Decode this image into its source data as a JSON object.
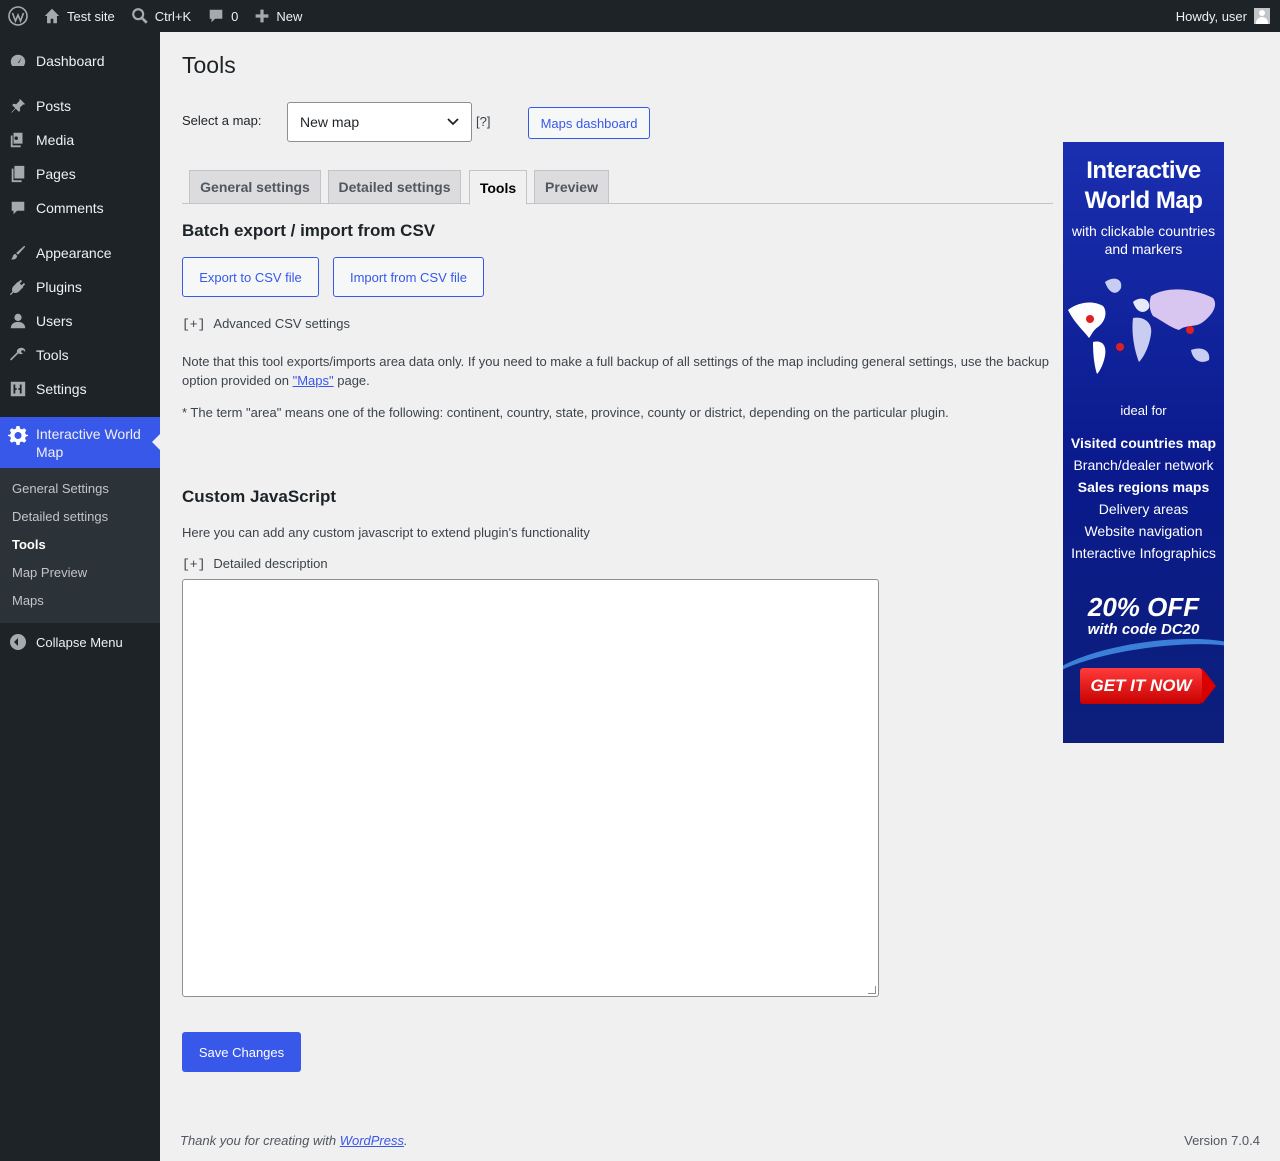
{
  "adminbar": {
    "site_name": "Test site",
    "search_shortcut": "Ctrl+K",
    "comments_count": "0",
    "new_label": "New",
    "howdy": "Howdy, user"
  },
  "sidebar": {
    "items": [
      {
        "label": "Dashboard",
        "icon": "dashboard-icon"
      },
      {
        "label": "Posts",
        "icon": "pin-icon"
      },
      {
        "label": "Media",
        "icon": "media-icon"
      },
      {
        "label": "Pages",
        "icon": "pages-icon"
      },
      {
        "label": "Comments",
        "icon": "comment-icon"
      },
      {
        "label": "Appearance",
        "icon": "brush-icon"
      },
      {
        "label": "Plugins",
        "icon": "plug-icon"
      },
      {
        "label": "Users",
        "icon": "user-icon"
      },
      {
        "label": "Tools",
        "icon": "wrench-icon"
      },
      {
        "label": "Settings",
        "icon": "sliders-icon"
      }
    ],
    "current": {
      "label": "Interactive World Map",
      "icon": "gear-icon"
    },
    "submenu": [
      "General Settings",
      "Detailed settings",
      "Tools",
      "Map Preview",
      "Maps"
    ],
    "submenu_active": "Tools",
    "collapse_label": "Collapse Menu"
  },
  "page": {
    "title": "Tools",
    "select_label": "Select a map:",
    "selected_map": "New map",
    "help": "[?]",
    "maps_dashboard": "Maps dashboard",
    "tabs": [
      "General settings",
      "Detailed settings",
      "Tools",
      "Preview"
    ],
    "active_tab": "Tools"
  },
  "csv": {
    "heading": "Batch export / import from CSV",
    "export_label": "Export to CSV file",
    "import_label": "Import from CSV file",
    "toggle": "[+]",
    "advanced_label": "Advanced CSV settings",
    "note_before": "Note that this tool exports/imports area data only. If you need to make a full backup of all settings of the map including general settings, use the backup option provided on ",
    "note_link": "\"Maps\"",
    "note_after": " page.",
    "term_note": "* The term \"area\" means one of the following: continent, country, state, province, county or district, depending on the particular plugin."
  },
  "custom_js": {
    "heading": "Custom JavaScript",
    "description": "Here you can add any custom javascript to extend plugin's functionality",
    "toggle": "[+]",
    "detailed_label": "Detailed description",
    "value": ""
  },
  "save_label": "Save Changes",
  "footer": {
    "thanks_before": "Thank you for creating with ",
    "thanks_link": "WordPress",
    "thanks_after": ".",
    "version": "Version 7.0.4"
  },
  "ad": {
    "title_line1": "Interactive",
    "title_line2": "World Map",
    "subtitle_line1": "with clickable countries",
    "subtitle_line2": "and markers",
    "ideal_for": "ideal for",
    "uses": [
      "Visited countries map",
      "Branch/dealer network",
      "Sales regions maps",
      "Delivery areas",
      "Website navigation",
      "Interactive Infographics"
    ],
    "discount": "20% OFF",
    "code": "with code DC20",
    "cta": "GET IT NOW"
  },
  "colors": {
    "accent": "#3858e9",
    "adminbar_bg": "#1d2327",
    "content_bg": "#f0f0f1"
  }
}
